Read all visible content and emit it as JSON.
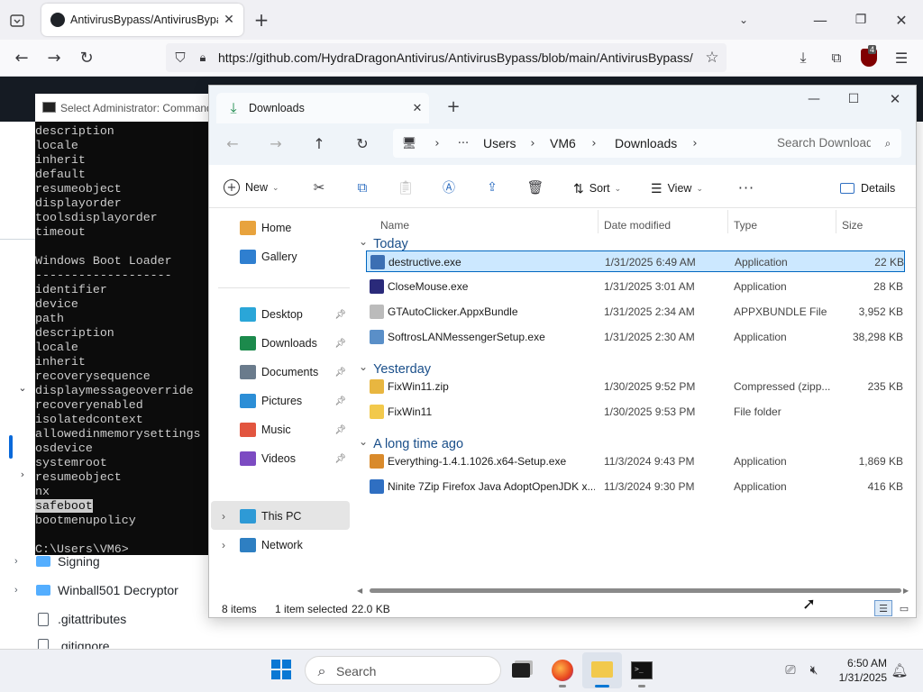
{
  "browser": {
    "tab_title": "AntivirusBypass/AntivirusBypass",
    "url": "https://github.com/HydraDragonAntivirus/AntivirusBypass/blob/main/AntivirusBypass/",
    "ublock_count": "4",
    "github_tree": [
      {
        "name": "Signing",
        "type": "folder"
      },
      {
        "name": "Winball501 Decryptor",
        "type": "folder"
      },
      {
        "name": ".gitattributes",
        "type": "file"
      },
      {
        "name": ".gitignore",
        "type": "file"
      }
    ]
  },
  "cmd": {
    "title": "Select Administrator: Command Prompt",
    "lines": [
      "description",
      "locale",
      "inherit",
      "default",
      "resumeobject",
      "displayorder",
      "toolsdisplayorder",
      "timeout",
      "",
      "Windows Boot Loader",
      "-------------------",
      "identifier",
      "device",
      "path",
      "description",
      "locale",
      "inherit",
      "recoverysequence",
      "displaymessageoverride",
      "recoveryenabled",
      "isolatedcontext",
      "allowedinmemorysettings",
      "osdevice",
      "systemroot",
      "resumeobject",
      "nx"
    ],
    "highlight_line": "safeboot",
    "after_lines": [
      "bootmenupolicy",
      "",
      "C:\\Users\\VM6>"
    ]
  },
  "explorer": {
    "tab_title": "Downloads",
    "breadcrumb": [
      "Users",
      "VM6",
      "Downloads"
    ],
    "search_placeholder": "Search Downloads",
    "toolbar": {
      "new": "New",
      "sort": "Sort",
      "view": "View",
      "details": "Details"
    },
    "nav": [
      {
        "label": "Home",
        "icon": "home-icon",
        "color": "#e8a33d",
        "pinned": false
      },
      {
        "label": "Gallery",
        "icon": "gallery-icon",
        "color": "#2f7fd0",
        "pinned": false
      },
      {
        "label": "Desktop",
        "icon": "desktop-icon",
        "color": "#2aa6d8",
        "pinned": true
      },
      {
        "label": "Downloads",
        "icon": "downloads-icon",
        "color": "#1c8a4c",
        "pinned": true
      },
      {
        "label": "Documents",
        "icon": "documents-icon",
        "color": "#6a7b8c",
        "pinned": true
      },
      {
        "label": "Pictures",
        "icon": "pictures-icon",
        "color": "#2c8ed6",
        "pinned": true
      },
      {
        "label": "Music",
        "icon": "music-icon",
        "color": "#e2553f",
        "pinned": true
      },
      {
        "label": "Videos",
        "icon": "videos-icon",
        "color": "#7c4bc2",
        "pinned": true
      },
      {
        "label": "This PC",
        "icon": "pc-icon",
        "color": "#2e9ad6",
        "pinned": false
      },
      {
        "label": "Network",
        "icon": "network-icon",
        "color": "#2e7fc2",
        "pinned": false
      }
    ],
    "columns": {
      "name": "Name",
      "date": "Date modified",
      "type": "Type",
      "size": "Size"
    },
    "groups": [
      {
        "label": "Today",
        "files": [
          {
            "name": "destructive.exe",
            "date": "1/31/2025 6:49 AM",
            "type": "Application",
            "size": "22 KB",
            "icon_color": "#3c6fb3"
          },
          {
            "name": "CloseMouse.exe",
            "date": "1/31/2025 3:01 AM",
            "type": "Application",
            "size": "28 KB",
            "icon_color": "#2a2a7a"
          },
          {
            "name": "GTAutoClicker.AppxBundle",
            "date": "1/31/2025 2:34 AM",
            "type": "APPXBUNDLE File",
            "size": "3,952 KB",
            "icon_color": "#bbbbbb"
          },
          {
            "name": "SoftrosLANMessengerSetup.exe",
            "date": "1/31/2025 2:30 AM",
            "type": "Application",
            "size": "38,298 KB",
            "icon_color": "#5a8fc8"
          }
        ]
      },
      {
        "label": "Yesterday",
        "files": [
          {
            "name": "FixWin11.zip",
            "date": "1/30/2025 9:52 PM",
            "type": "Compressed (zipp...",
            "size": "235 KB",
            "icon_color": "#e8b640"
          },
          {
            "name": "FixWin11",
            "date": "1/30/2025 9:53 PM",
            "type": "File folder",
            "size": "",
            "icon_color": "#f2c94c"
          }
        ]
      },
      {
        "label": "A long time ago",
        "files": [
          {
            "name": "Everything-1.4.1.1026.x64-Setup.exe",
            "date": "11/3/2024 9:43 PM",
            "type": "Application",
            "size": "1,869 KB",
            "icon_color": "#d98a2b"
          },
          {
            "name": "Ninite 7Zip Firefox Java AdoptOpenJDK x...",
            "date": "11/3/2024 9:30 PM",
            "type": "Application",
            "size": "416 KB",
            "icon_color": "#2f6fc2"
          }
        ]
      }
    ],
    "status": {
      "items": "8 items",
      "selected": "1 item selected",
      "size": "22.0 KB"
    }
  },
  "taskbar": {
    "search_placeholder": "Search",
    "time": "6:50 AM",
    "date": "1/31/2025"
  }
}
